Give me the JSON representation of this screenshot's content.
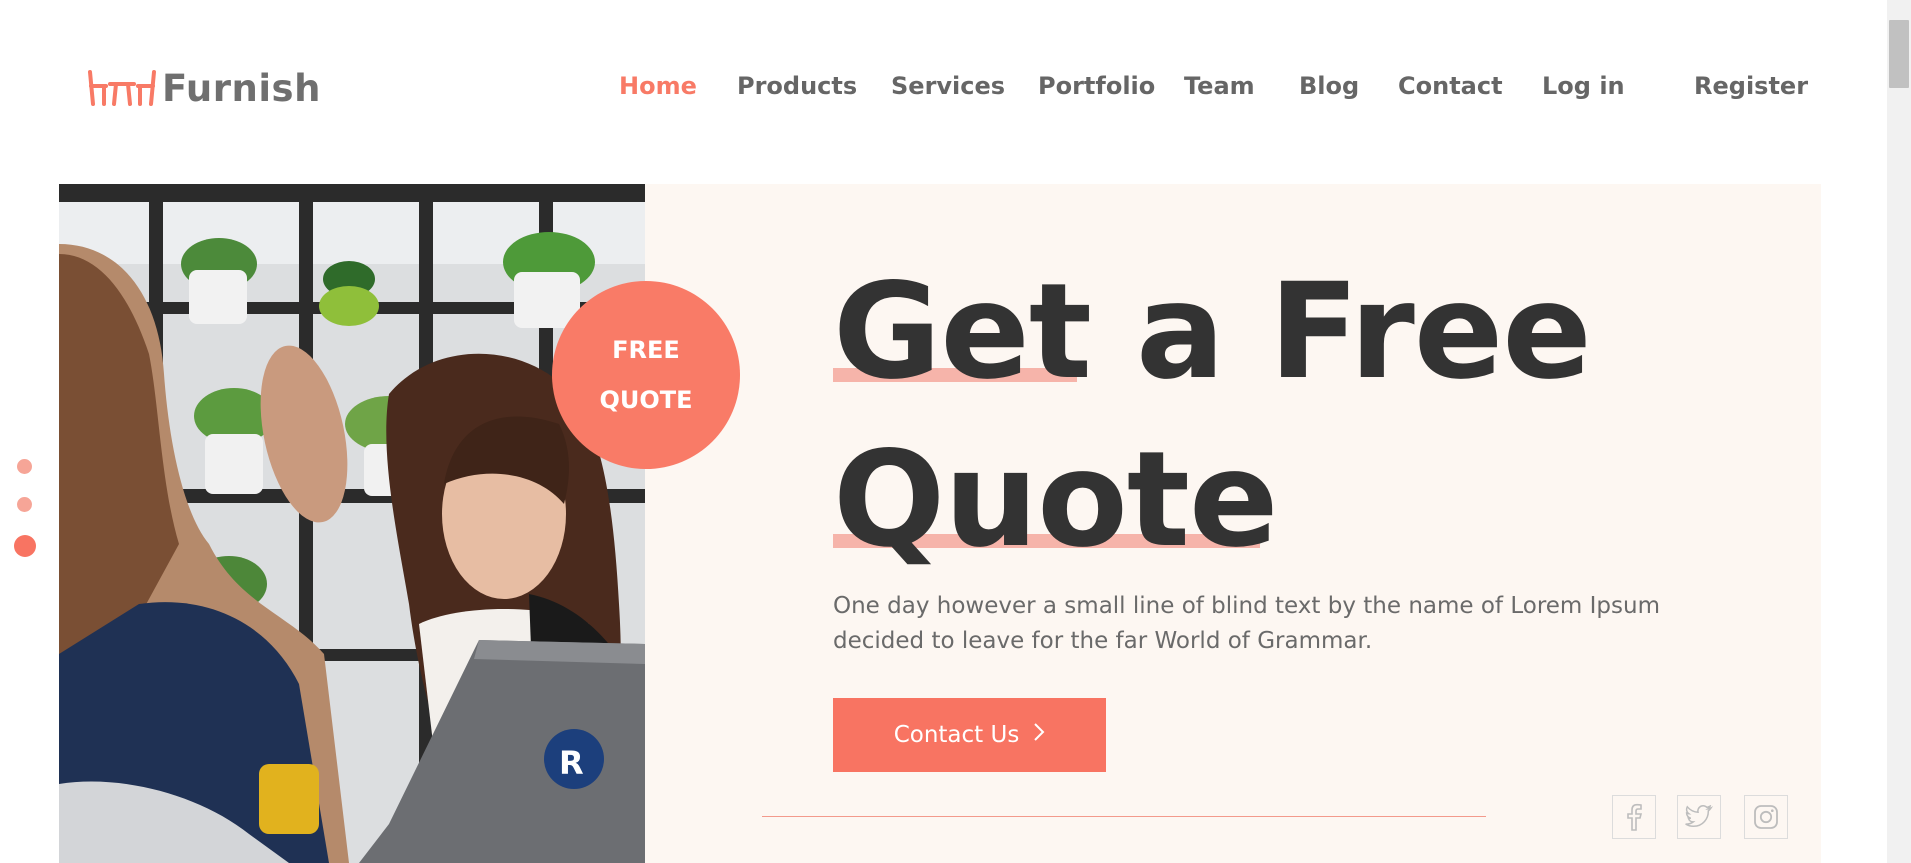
{
  "brand": {
    "name": "Furnish",
    "accent_color": "#f87462",
    "logo_icon": "furniture-chairs-icon"
  },
  "nav": {
    "items": [
      {
        "label": "Home",
        "active": true
      },
      {
        "label": "Products",
        "active": false
      },
      {
        "label": "Services",
        "active": false
      },
      {
        "label": "Portfolio",
        "active": false
      },
      {
        "label": "Team",
        "active": false
      },
      {
        "label": "Blog",
        "active": false
      },
      {
        "label": "Contact",
        "active": false
      },
      {
        "label": "Log in",
        "active": false
      },
      {
        "label": "Register",
        "active": false
      }
    ]
  },
  "badge": {
    "line1": "FREE",
    "line2": "QUOTE"
  },
  "hero": {
    "headline_line1_part1": "Get",
    "headline_line1_part2": " a Free",
    "headline_line2": "Quote",
    "description": "One day however a small line of blind text by the name of Lorem Ipsum decided to leave for the far World of Grammar.",
    "cta_label": "Contact Us",
    "cta_icon": "chevron-right-icon",
    "image_subject": "office-meeting-photo"
  },
  "social": [
    {
      "name": "facebook-icon"
    },
    {
      "name": "twitter-icon"
    },
    {
      "name": "instagram-icon"
    }
  ],
  "slider": {
    "count": 3,
    "active_index": 2
  }
}
